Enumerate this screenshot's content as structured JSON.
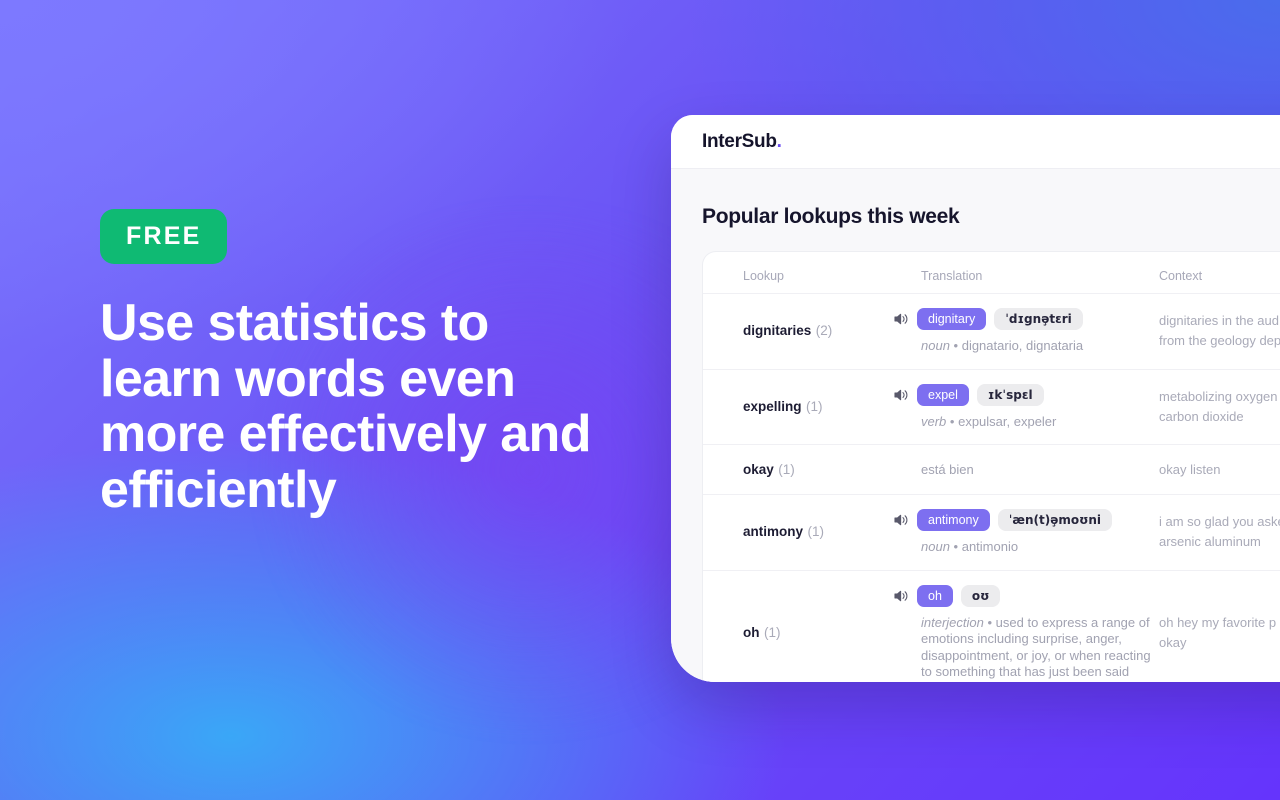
{
  "hero": {
    "badge_label": "FREE",
    "headline": "Use statistics to learn words even more effectively and efficiently",
    "badge_color": "#0fba73"
  },
  "app": {
    "logo_name": "InterSub",
    "logo_dot": ".",
    "accent_color": "#6c4ff0",
    "section_title": "Popular lookups this week",
    "table": {
      "columns": [
        "Lookup",
        "Translation",
        "Context"
      ],
      "rows": [
        {
          "word": "dignitaries",
          "count": "(2)",
          "has_audio": true,
          "badge": "dignitary",
          "ipa": "ˈdɪgnə̧tɛri",
          "pos": "noun",
          "sense": "• dignatario, dignataria",
          "context": "dignitaries in the aud\nfrom the geology dep"
        },
        {
          "word": "expelling",
          "count": "(1)",
          "has_audio": true,
          "badge": "expel",
          "ipa": "ɪkˈspɛl",
          "pos": "verb",
          "sense": "• expulsar, expeler",
          "context": "metabolizing oxygen\ncarbon  dioxide"
        },
        {
          "word": "okay",
          "count": "(1)",
          "has_audio": false,
          "badge": "",
          "ipa": "",
          "pos": "",
          "sense": "",
          "plain_translation": "está bien",
          "context": "okay  listen"
        },
        {
          "word": "antimony",
          "count": "(1)",
          "has_audio": true,
          "badge": "antimony",
          "ipa": "ˈæn(t)ə̧moʊni",
          "pos": "noun",
          "sense": "• antimonio",
          "context": "i am so glad you aske\narsenic aluminum"
        },
        {
          "word": "oh",
          "count": "(1)",
          "has_audio": true,
          "badge": "oh",
          "ipa": "oʊ",
          "pos": "interjection",
          "sense": "• used to express a range of emotions including surprise, anger, disappointment, or joy, or when reacting to something that has just been said",
          "context": "oh  hey my favorite p\nokay"
        }
      ]
    }
  }
}
